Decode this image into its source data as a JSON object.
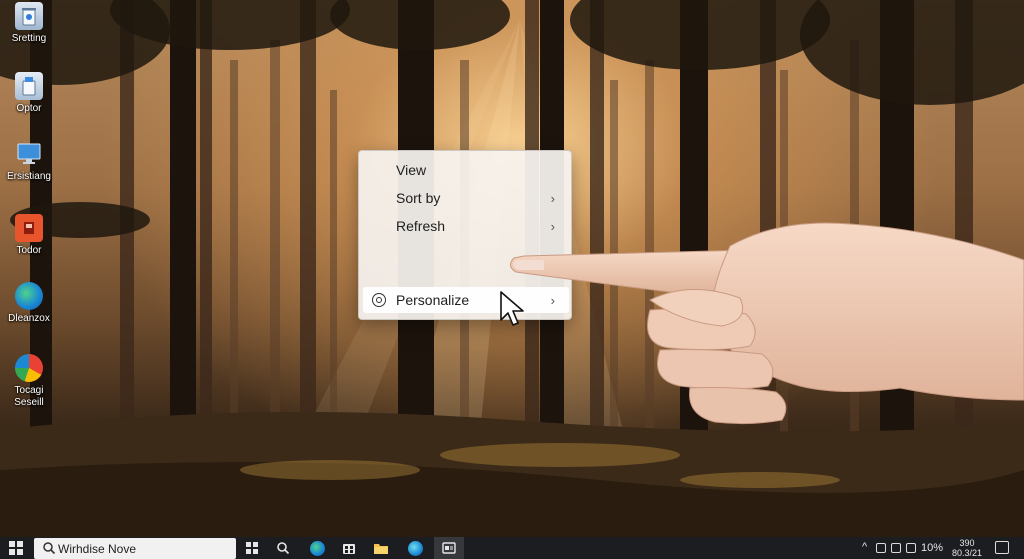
{
  "desktop": {
    "icons": [
      {
        "label": "Sretting",
        "icon": "recycle-bin-icon"
      },
      {
        "label": "Optor",
        "icon": "recycle-bin-full-icon"
      },
      {
        "label": "Ersistiang",
        "icon": "monitor-icon"
      },
      {
        "label": "Todor",
        "icon": "app-red-icon"
      },
      {
        "label": "Dleanzox",
        "icon": "edge-icon"
      },
      {
        "label": "Tocagi\nSeseill",
        "icon": "chrome-edge-icon"
      }
    ]
  },
  "context_menu": {
    "items": [
      {
        "label": "View",
        "has_submenu": false
      },
      {
        "label": "Sort by",
        "has_submenu": true
      },
      {
        "label": "Refresh",
        "has_submenu": true
      },
      {
        "label": "Personalize",
        "has_submenu": true,
        "highlighted": true,
        "icon": "personalize-icon"
      }
    ],
    "chevron": "›"
  },
  "taskbar": {
    "search_value": "Wirhdise Nove",
    "apps": [
      "task-view-icon",
      "search-icon",
      "edge-icon",
      "store-icon",
      "file-explorer-icon",
      "edge-icon",
      "settings-app-icon"
    ],
    "tray": {
      "chevron": "^",
      "battery": "10%",
      "time": "390",
      "date": "80.3/21"
    }
  },
  "colors": {
    "taskbar_bg": "#1c1d21",
    "menu_bg": "#f6f3f0",
    "edge_blue": "#1b8ad3"
  }
}
